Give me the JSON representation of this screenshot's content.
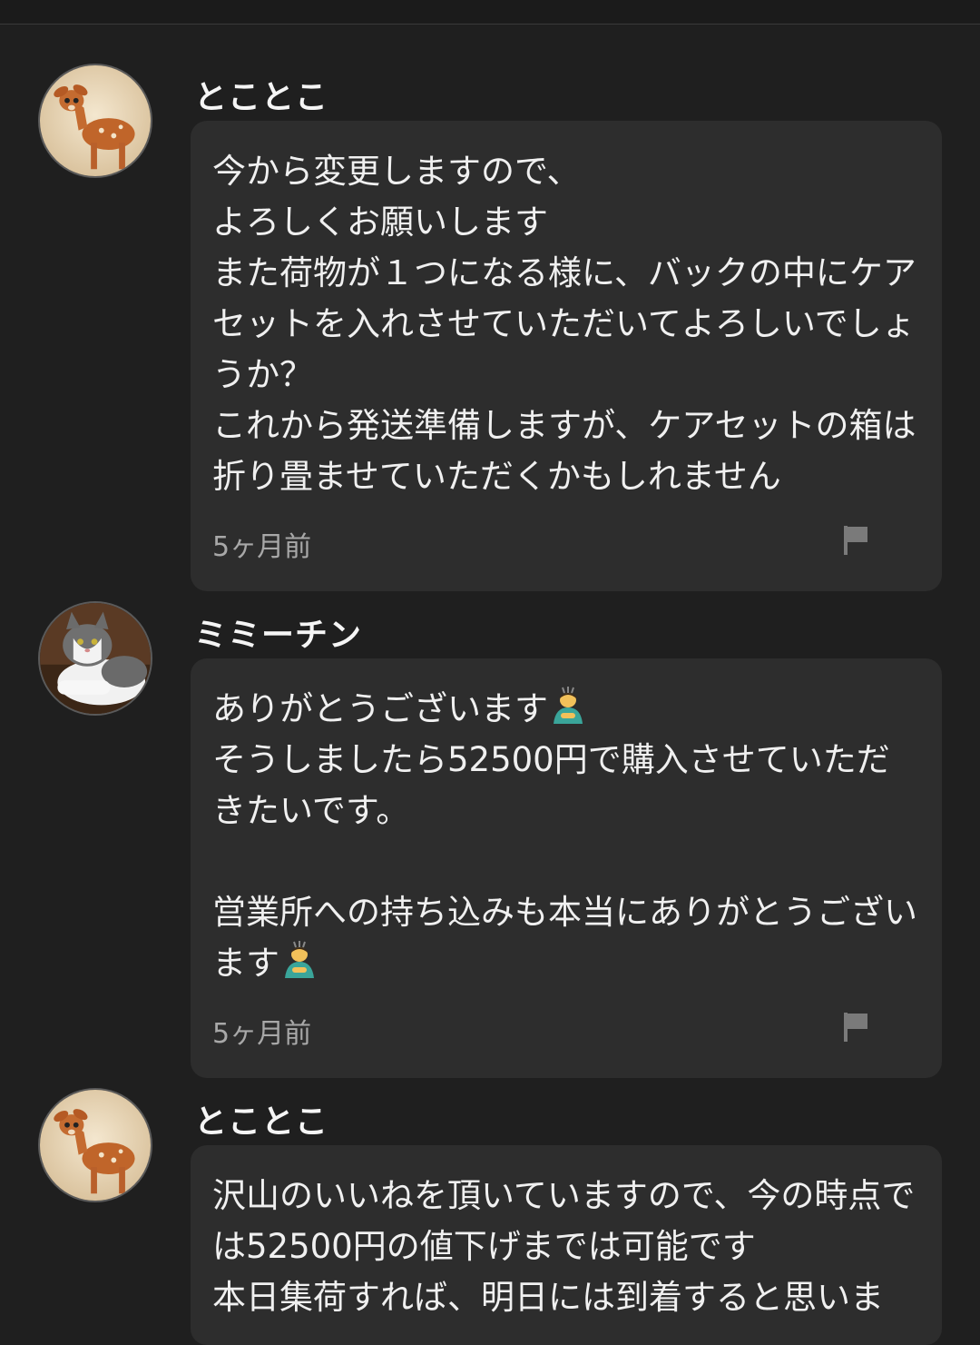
{
  "messages": [
    {
      "user": "とことこ",
      "avatar": "deer-avatar",
      "text": "今から変更しますので、\nよろしくお願いします\nまた荷物が１つになる様に、バックの中にケアセットを入れさせていただいてよろしいでしょうか？\nこれから発送準備しますが、ケアセットの箱は折り畳ませていただくかもしれません",
      "time": "5ヶ月前"
    },
    {
      "user": "ミミーチン",
      "avatar": "cat-avatar",
      "text_part1": "ありがとうございます",
      "emoji1": "bowing-person-emoji",
      "text_part2": "\nそうしましたら52500円で購入させていただきたいです。\n\n営業所への持ち込みも本当にありがとうございます",
      "emoji2": "bowing-person-emoji",
      "time": "5ヶ月前"
    },
    {
      "user": "とことこ",
      "avatar": "deer-avatar",
      "text": "沢山のいいねを頂いていますので、今の時点では52500円の値下げまでは可能です\n本日集荷すれば、明日には到着すると思いま"
    }
  ],
  "icons": {
    "report": "flag-icon"
  },
  "colors": {
    "background": "#1f1f1f",
    "bubble": "#2d2d2d",
    "text": "#f0f0f0",
    "muted": "#a8a8a8"
  }
}
